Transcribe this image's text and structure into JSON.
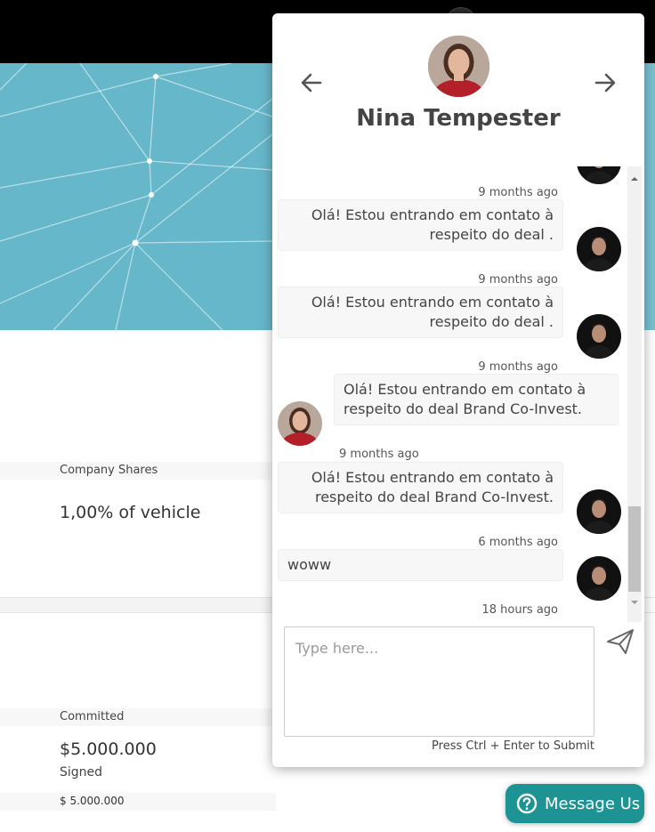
{
  "background": {
    "fields": [
      {
        "label": "Company Shares",
        "value": "1,00% of vehicle"
      },
      {
        "label": "Committed",
        "value": "$5.000.000",
        "sub_label": "Signed",
        "sub_value": "$ 5.000.000"
      }
    ]
  },
  "chat": {
    "contact_name": "Nina Tempester",
    "messages": [
      {
        "direction": "out",
        "text": "",
        "time": "9 months ago"
      },
      {
        "direction": "out",
        "text": "Olá! Estou entrando em contato à respeito do deal .",
        "time": "9 months ago"
      },
      {
        "direction": "out",
        "text": "Olá! Estou entrando em contato à respeito do deal .",
        "time": "9 months ago"
      },
      {
        "direction": "in",
        "text": "Olá! Estou entrando em contato à respeito do deal Brand Co-Invest.",
        "time": "9 months ago"
      },
      {
        "direction": "out",
        "text": "Olá! Estou entrando em contato à respeito do deal Brand Co-Invest.",
        "time": "6 months ago"
      },
      {
        "direction": "out",
        "text": "woww",
        "time": "18 hours ago"
      }
    ],
    "input_placeholder": "Type here...",
    "submit_hint": "Press Ctrl + Enter to Submit"
  },
  "message_us_label": "Message Us",
  "colors": {
    "accent": "#1d9393",
    "topbar": "#000000",
    "hero": "#67b7cb"
  },
  "icons": [
    "arrow-left-icon",
    "arrow-right-icon",
    "send-icon",
    "question-circle-icon",
    "scroll-up-icon",
    "scroll-down-icon"
  ]
}
